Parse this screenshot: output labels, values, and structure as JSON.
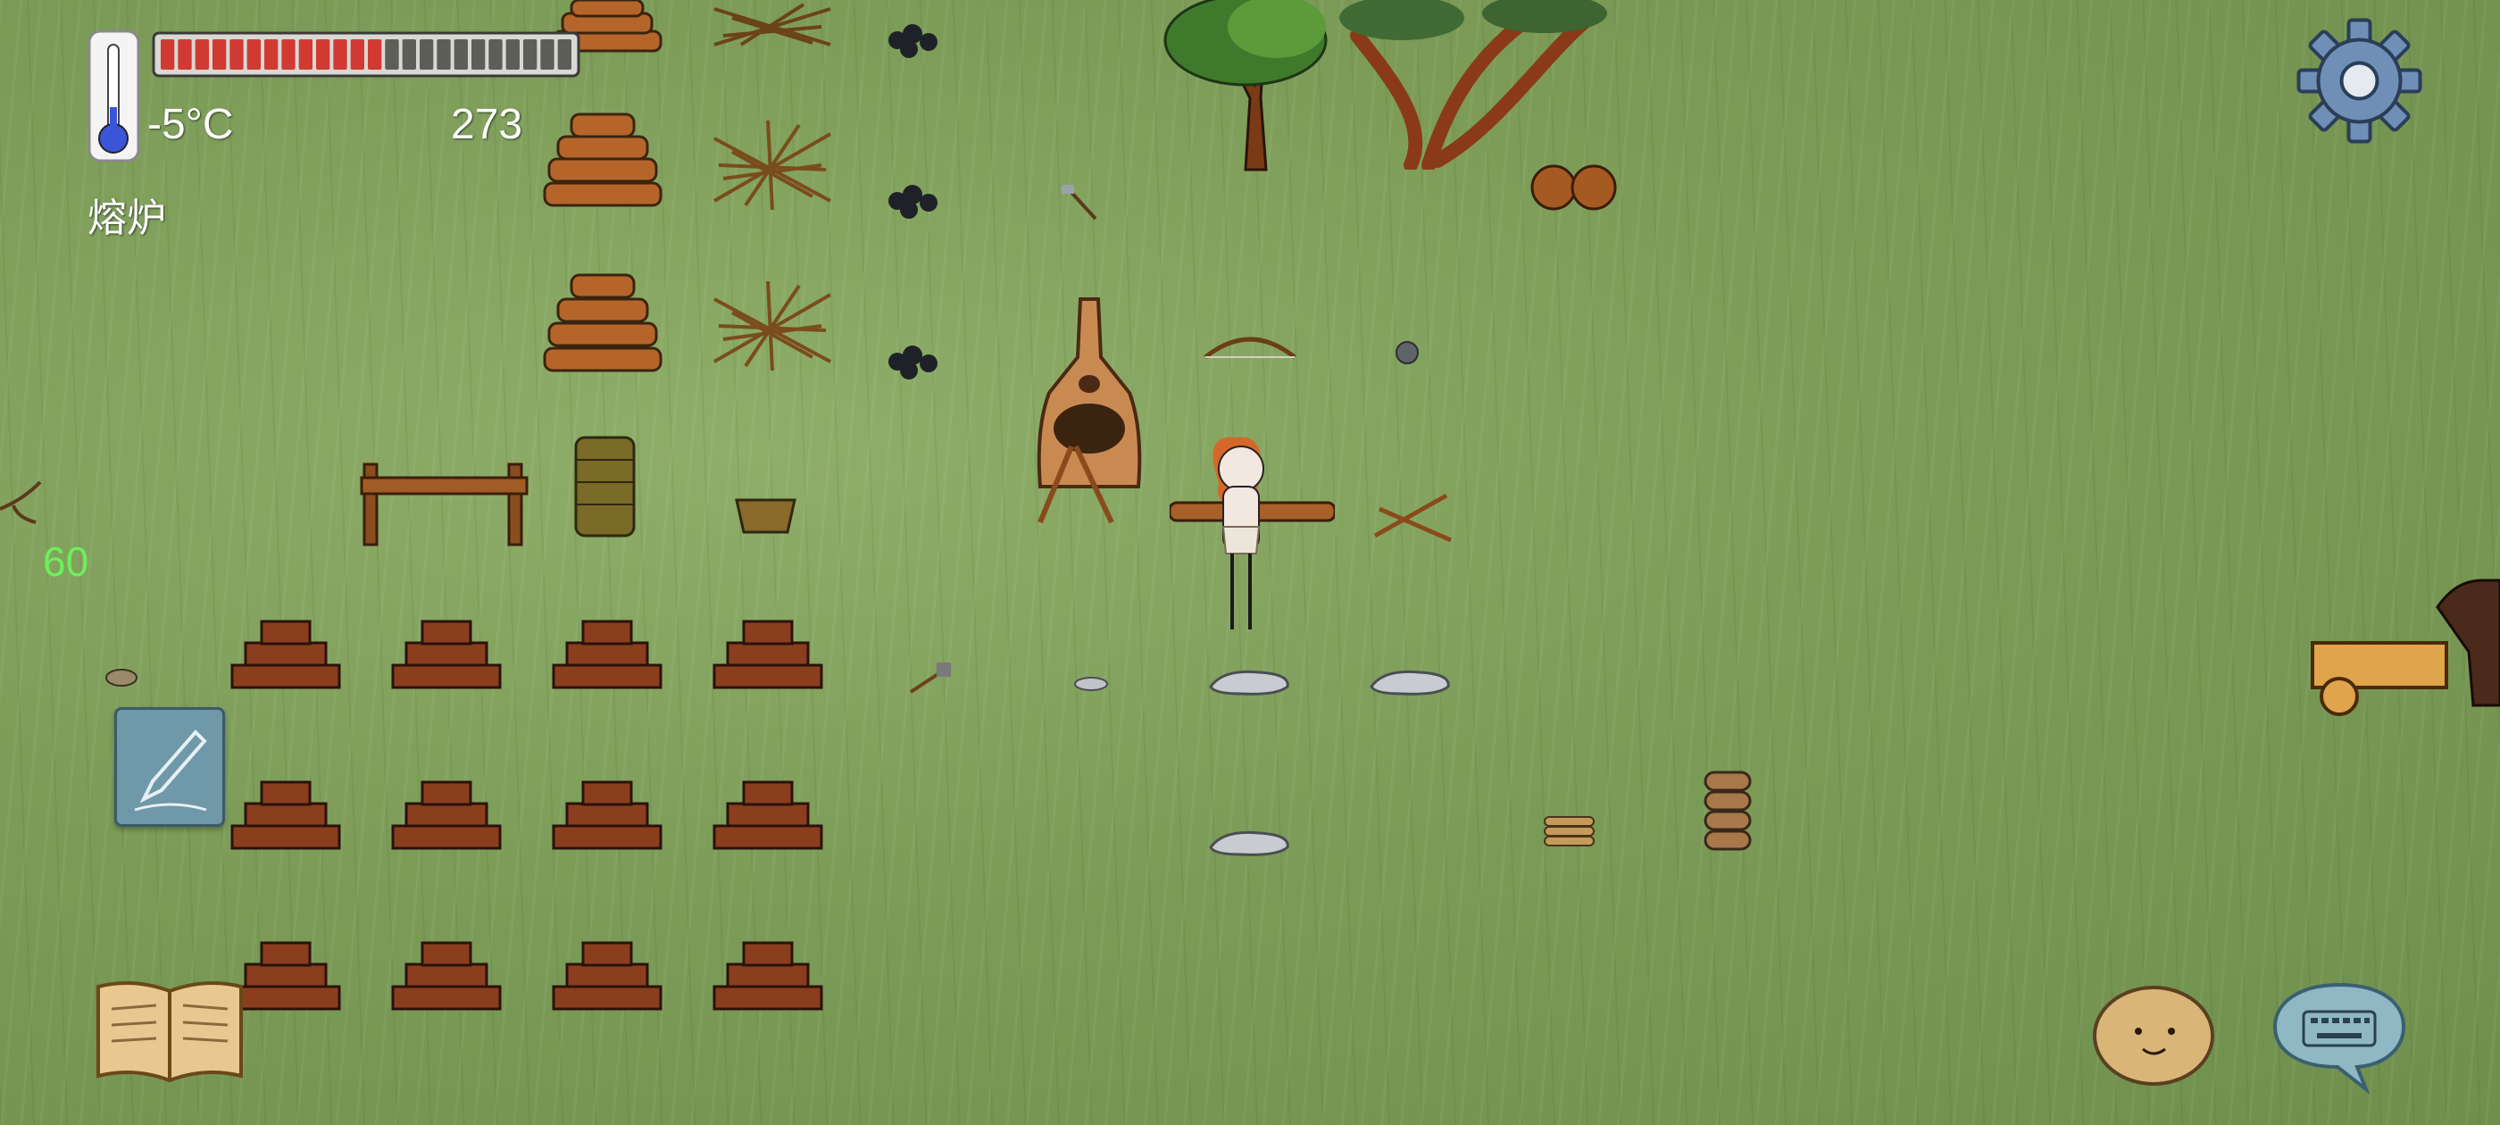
{
  "hud": {
    "temperature": "-5°C",
    "score": "273",
    "location_label": "熔炉",
    "fps": "60",
    "health_fraction": 0.54,
    "health_segments_total": 24,
    "health_segments_filled": 13
  },
  "colors": {
    "health_fill": "#d13a33",
    "health_empty": "#5c5e58",
    "fps_text": "#6cf05a",
    "thermometer_bulb": "#3a55d8",
    "grass": "#7f9f5b"
  },
  "icons": {
    "thermometer": "thermometer-icon",
    "settings": "gear-icon",
    "journal": "open-book-icon",
    "edit": "pencil-icon",
    "emote": "potato-face-icon",
    "chat": "keyboard-speech-bubble-icon"
  }
}
